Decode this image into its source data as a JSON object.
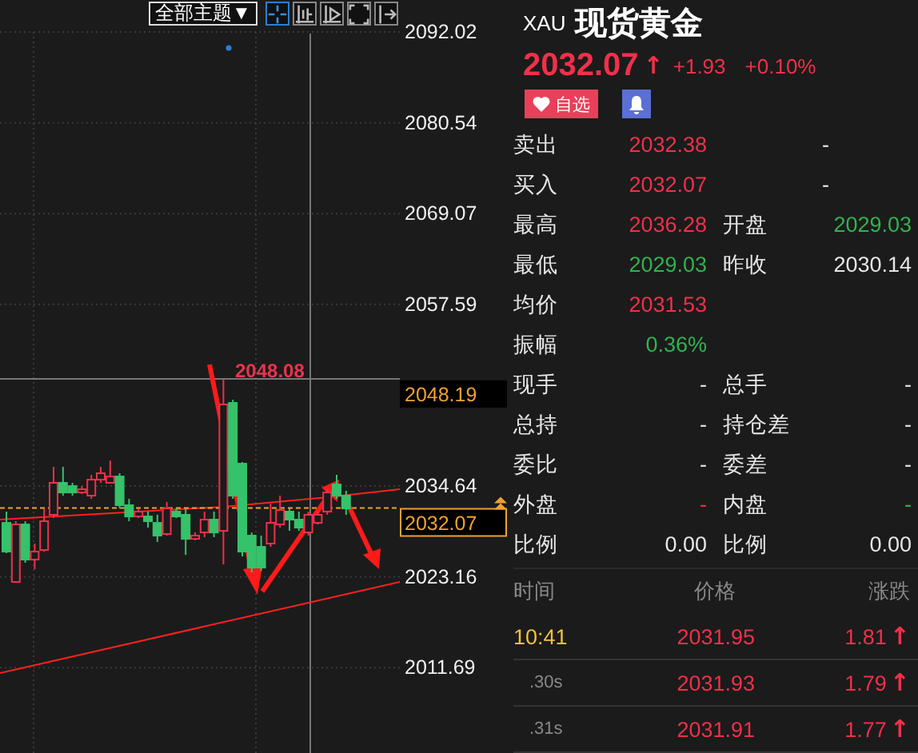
{
  "toolbar": {
    "theme_button": "全部主题▼",
    "tools": [
      {
        "kind": "crosshair",
        "selected": true
      },
      {
        "kind": "bar-adjust",
        "selected": false
      },
      {
        "kind": "play-bar",
        "selected": false
      },
      {
        "kind": "fullscreen",
        "selected": false
      },
      {
        "kind": "exit-right",
        "selected": false
      }
    ]
  },
  "chart": {
    "high_marker": "2048.08",
    "crosshair_price": "2048.19",
    "current_price": "2032.07",
    "chart_data": {
      "type": "candlestick",
      "grid": true,
      "ylim": [
        2000.91,
        2092.02
      ],
      "ref_lines": [
        {
          "axis": "y",
          "value": 2032.07
        },
        {
          "axis": "y",
          "value": 2048.19
        }
      ],
      "yticks": [
        2092.02,
        2080.54,
        2069.07,
        2057.59,
        2034.64,
        2023.16,
        2011.69
      ],
      "ohlc": [
        [
          2029.99,
          2031.41,
          2026.16,
          2026.36
        ],
        [
          2022.52,
          2030.2,
          2022.52,
          2029.79
        ],
        [
          2029.79,
          2030.2,
          2024.95,
          2025.35
        ],
        [
          2025.35,
          2027.37,
          2024.14,
          2026.36
        ],
        [
          2026.56,
          2031.81,
          2026.36,
          2030.2
        ],
        [
          2031.01,
          2037.07,
          2030.6,
          2035.05
        ],
        [
          2035.05,
          2037.07,
          2033.43,
          2033.83
        ],
        [
          2034.64,
          2035.05,
          2033.43,
          2033.83
        ],
        [
          2033.83,
          2034.64,
          2033.63,
          2034.24
        ],
        [
          2033.43,
          2036.06,
          2033.03,
          2035.45
        ],
        [
          2035.45,
          2037.07,
          2035.05,
          2036.26
        ],
        [
          2035.05,
          2037.87,
          2035.05,
          2035.85
        ],
        [
          2035.85,
          2036.26,
          2031.81,
          2032.22
        ],
        [
          2032.22,
          2033.03,
          2030.2,
          2030.8
        ],
        [
          2030.8,
          2031.81,
          2030.6,
          2031.41
        ],
        [
          2030.8,
          2031.41,
          2029.39,
          2030.2
        ],
        [
          2029.99,
          2031.01,
          2027.57,
          2028.38
        ],
        [
          2028.58,
          2032.62,
          2028.38,
          2031.81
        ],
        [
          2031.41,
          2031.81,
          2030.6,
          2030.8
        ],
        [
          2031.01,
          2031.81,
          2025.95,
          2027.97
        ],
        [
          2027.97,
          2028.78,
          2027.77,
          2028.38
        ],
        [
          2028.78,
          2031.41,
          2028.18,
          2030.4
        ],
        [
          2030.4,
          2031.41,
          2028.18,
          2028.78
        ],
        [
          2028.98,
          2048.08,
          2024.74,
          2044.95
        ],
        [
          2045.15,
          2045.55,
          2033.03,
          2033.43
        ],
        [
          2037.47,
          2037.67,
          2025.75,
          2026.36
        ],
        [
          2028.38,
          2028.78,
          2023.73,
          2024.34
        ],
        [
          2026.96,
          2028.38,
          2023.93,
          2024.34
        ],
        [
          2027.37,
          2032.42,
          2026.96,
          2029.99
        ],
        [
          2029.79,
          2033.43,
          2029.39,
          2031.61
        ],
        [
          2031.41,
          2031.81,
          2028.98,
          2030.4
        ],
        [
          2030.4,
          2031.41,
          2028.98,
          2029.39
        ],
        [
          2028.78,
          2031.41,
          2028.38,
          2031.01
        ],
        [
          2029.99,
          2031.41,
          2029.79,
          2031.01
        ],
        [
          2031.41,
          2034.24,
          2031.01,
          2033.83
        ],
        [
          2034.84,
          2036.06,
          2033.03,
          2033.43
        ],
        [
          2033.43,
          2034.04,
          2031.01,
          2031.81
        ]
      ]
    }
  },
  "quote": {
    "symbol": "XAU",
    "name": "现货黄金",
    "price": "2032.07",
    "arrow": "↑",
    "change": "+1.93",
    "change_percent": "+0.10%",
    "watch_button": "自选"
  },
  "stats": [
    {
      "kind": "single",
      "label": "卖出",
      "value": {
        "text": "2032.38",
        "color": "#f0304a"
      },
      "value2": {
        "text": "-",
        "color": "#e6e6e6"
      }
    },
    {
      "kind": "single",
      "label": "买入",
      "value": {
        "text": "2032.07",
        "color": "#f0304a"
      },
      "value2": {
        "text": "-",
        "color": "#e6e6e6"
      }
    },
    {
      "kind": "pair",
      "label": "最高",
      "value": {
        "text": "2036.28",
        "color": "#f0304a"
      },
      "label2": "开盘",
      "value2": {
        "text": "2029.03",
        "color": "#2fb34e"
      }
    },
    {
      "kind": "pair",
      "label": "最低",
      "value": {
        "text": "2029.03",
        "color": "#2fb34e"
      },
      "label2": "昨收",
      "value2": {
        "text": "2030.14",
        "color": "#e6e6e6"
      }
    },
    {
      "kind": "one",
      "label": "均价",
      "value": {
        "text": "2031.53",
        "color": "#f0304a"
      }
    },
    {
      "kind": "one",
      "label": "振幅",
      "value": {
        "text": "0.36%",
        "color": "#2fb34e"
      }
    },
    {
      "kind": "pair",
      "label": "现手",
      "value": {
        "text": "-",
        "color": "#e6e6e6"
      },
      "label2": "总手",
      "value2": {
        "text": "-",
        "color": "#e6e6e6"
      }
    },
    {
      "kind": "pair",
      "label": "总持",
      "value": {
        "text": "-",
        "color": "#e6e6e6"
      },
      "label2": "持仓差",
      "value2": {
        "text": "-",
        "color": "#e6e6e6"
      }
    },
    {
      "kind": "pair",
      "label": "委比",
      "value": {
        "text": "-",
        "color": "#e6e6e6"
      },
      "label2": "委差",
      "value2": {
        "text": "-",
        "color": "#e6e6e6"
      }
    },
    {
      "kind": "pair",
      "label": "外盘",
      "value": {
        "text": "-",
        "color": "#f0304a"
      },
      "label2": "内盘",
      "value2": {
        "text": "-",
        "color": "#2fb34e"
      }
    },
    {
      "kind": "pair",
      "label": "比例",
      "value": {
        "text": "0.00",
        "color": "#e6e6e6"
      },
      "label2": "比例",
      "value2": {
        "text": "0.00",
        "color": "#e6e6e6"
      }
    }
  ],
  "trades": {
    "columns": [
      "时间",
      "价格",
      "涨跌"
    ],
    "rows": [
      {
        "time": "10:41",
        "color": "#f0c040",
        "price": "2031.95",
        "change": "1.81",
        "arrow": "↑"
      },
      {
        "time": ".30s",
        "color": "#888888",
        "price": "2031.93",
        "change": "1.79",
        "arrow": "↑"
      },
      {
        "time": ".31s",
        "color": "#888888",
        "price": "2031.91",
        "change": "1.77",
        "arrow": "↑"
      }
    ]
  }
}
